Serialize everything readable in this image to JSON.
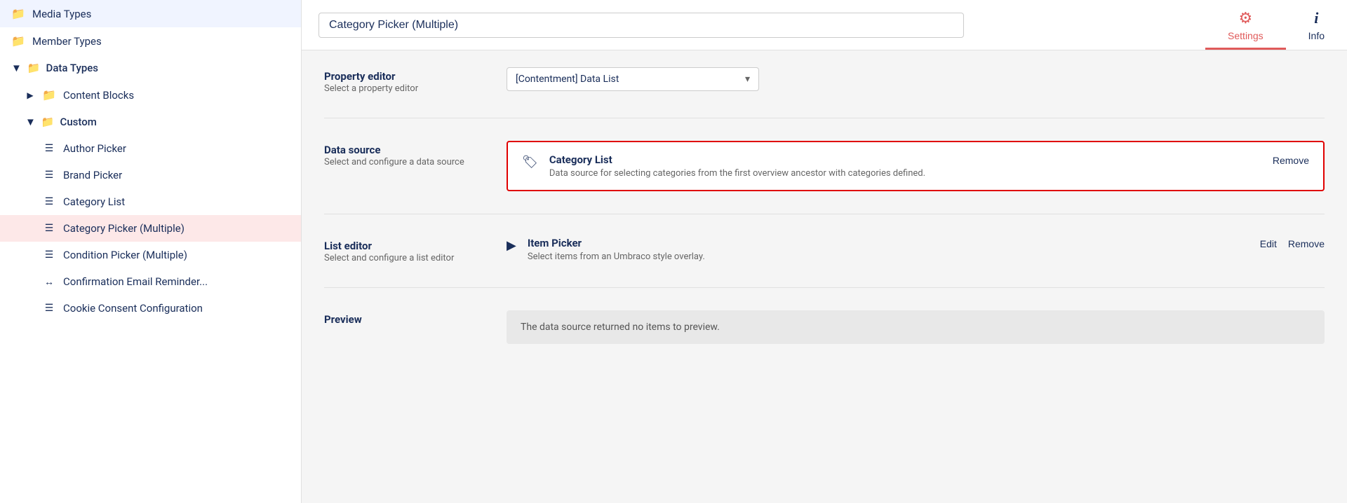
{
  "sidebar": {
    "items": [
      {
        "id": "media-types",
        "label": "Media Types",
        "type": "folder-top",
        "icon": "folder",
        "indent": 0
      },
      {
        "id": "member-types",
        "label": "Member Types",
        "type": "folder-top",
        "icon": "folder",
        "indent": 0
      },
      {
        "id": "data-types",
        "label": "Data Types",
        "type": "folder-expanded",
        "icon": "folder",
        "indent": 0
      },
      {
        "id": "content-blocks",
        "label": "Content Blocks",
        "type": "folder-child",
        "icon": "folder",
        "indent": 1
      },
      {
        "id": "custom",
        "label": "Custom",
        "type": "folder-child-expanded",
        "icon": "folder",
        "indent": 1
      },
      {
        "id": "author-picker",
        "label": "Author Picker",
        "type": "list-item",
        "icon": "list",
        "indent": 2
      },
      {
        "id": "brand-picker",
        "label": "Brand Picker",
        "type": "list-item",
        "icon": "list",
        "indent": 2
      },
      {
        "id": "category-list",
        "label": "Category List",
        "type": "list-item",
        "icon": "list",
        "indent": 2
      },
      {
        "id": "category-picker-multiple",
        "label": "Category Picker (Multiple)",
        "type": "list-item-active",
        "icon": "list",
        "indent": 2
      },
      {
        "id": "condition-picker-multiple",
        "label": "Condition Picker (Multiple)",
        "type": "list-item",
        "icon": "list",
        "indent": 2
      },
      {
        "id": "confirmation-email-reminder",
        "label": "Confirmation Email Reminder...",
        "type": "list-item-arrow",
        "icon": "arrow",
        "indent": 2
      },
      {
        "id": "cookie-consent-configuration",
        "label": "Cookie Consent Configuration",
        "type": "list-item",
        "icon": "list",
        "indent": 2
      }
    ]
  },
  "header": {
    "title_value": "Category Picker (Multiple)",
    "tabs": [
      {
        "id": "settings",
        "label": "Settings",
        "icon": "⚙",
        "active": true
      },
      {
        "id": "info",
        "label": "Info",
        "icon": "ℹ",
        "active": false
      }
    ]
  },
  "form": {
    "property_editor": {
      "label": "Property editor",
      "sublabel": "Select a property editor",
      "value": "[Contentment] Data List"
    },
    "data_source": {
      "label": "Data source",
      "sublabel": "Select and configure a data source",
      "source_title": "Category List",
      "source_desc": "Data source for selecting categories from the first overview ancestor with categories defined.",
      "remove_label": "Remove"
    },
    "list_editor": {
      "label": "List editor",
      "sublabel": "Select and configure a list editor",
      "editor_title": "Item Picker",
      "editor_desc": "Select items from an Umbraco style overlay.",
      "edit_label": "Edit",
      "remove_label": "Remove"
    },
    "preview": {
      "label": "Preview",
      "value": "The data source returned no items to preview."
    }
  }
}
